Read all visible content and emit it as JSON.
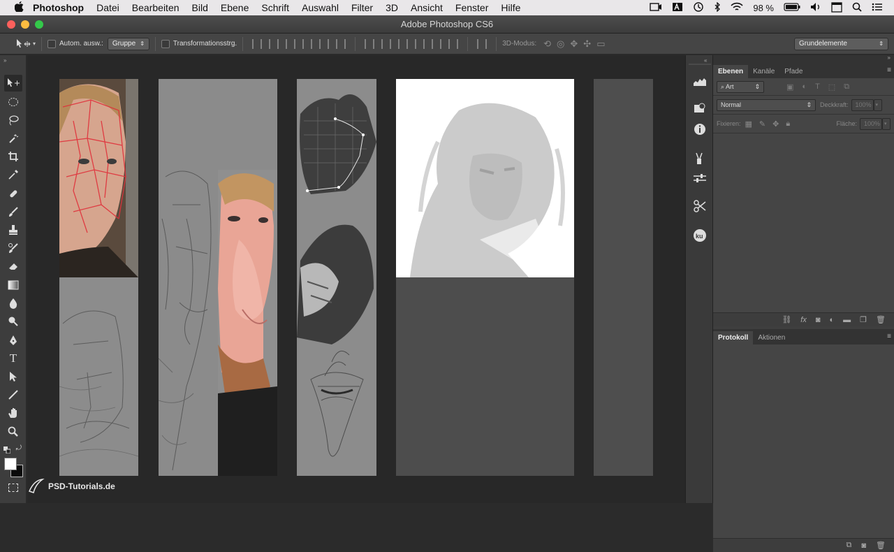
{
  "menubar": {
    "apple": "",
    "items": [
      "Photoshop",
      "Datei",
      "Bearbeiten",
      "Bild",
      "Ebene",
      "Schrift",
      "Auswahl",
      "Filter",
      "3D",
      "Ansicht",
      "Fenster",
      "Hilfe"
    ],
    "battery": "98 %"
  },
  "window": {
    "title": "Adobe Photoshop CS6"
  },
  "options": {
    "auto_select_label": "Autom. ausw.:",
    "auto_select_value": "Gruppe",
    "transform_label": "Transformationsstrg.",
    "mode_3d": "3D-Modus:",
    "workspace": "Grundelemente"
  },
  "layers_panel": {
    "tabs": [
      "Ebenen",
      "Kanäle",
      "Pfade"
    ],
    "filter_kind": "Art",
    "blend_mode": "Normal",
    "opacity_label": "Deckkraft:",
    "opacity_value": "100%",
    "lock_label": "Fixieren:",
    "fill_label": "Fläche:",
    "fill_value": "100%"
  },
  "history_panel": {
    "tabs": [
      "Protokoll",
      "Aktionen"
    ]
  },
  "watermark": "PSD-Tutorials.de",
  "colors": {
    "canvas_bg": "#282828",
    "panel_grey": "#8c8c8c",
    "accent_red": "#e0303a",
    "skin": "#e9a596"
  }
}
